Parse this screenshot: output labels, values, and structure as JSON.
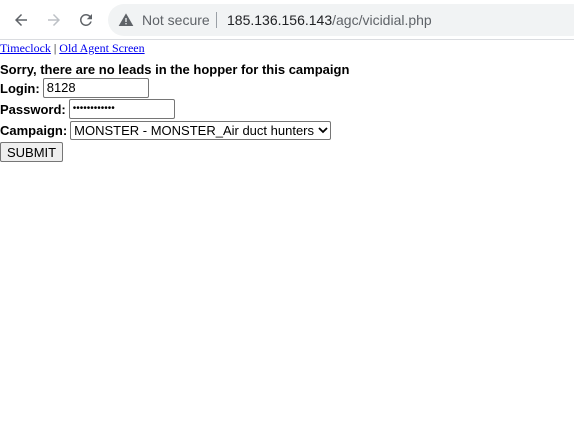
{
  "browser": {
    "security_label": "Not secure",
    "url_host": "185.136.156.143",
    "url_path": "/agc/vicidial.php"
  },
  "page": {
    "links": {
      "timeclock": "Timeclock",
      "separator": "|",
      "old_agent_screen": "Old Agent Screen"
    },
    "notice": "Sorry, there are no leads in the hopper for this campaign",
    "form": {
      "login_label": "Login:",
      "login_value": "8128",
      "password_label": "Password:",
      "password_value": "••••••••••••",
      "campaign_label": "Campaign:",
      "campaign_selected": "MONSTER - MONSTER_Air duct hunters",
      "submit_label": "SUBMIT"
    }
  }
}
